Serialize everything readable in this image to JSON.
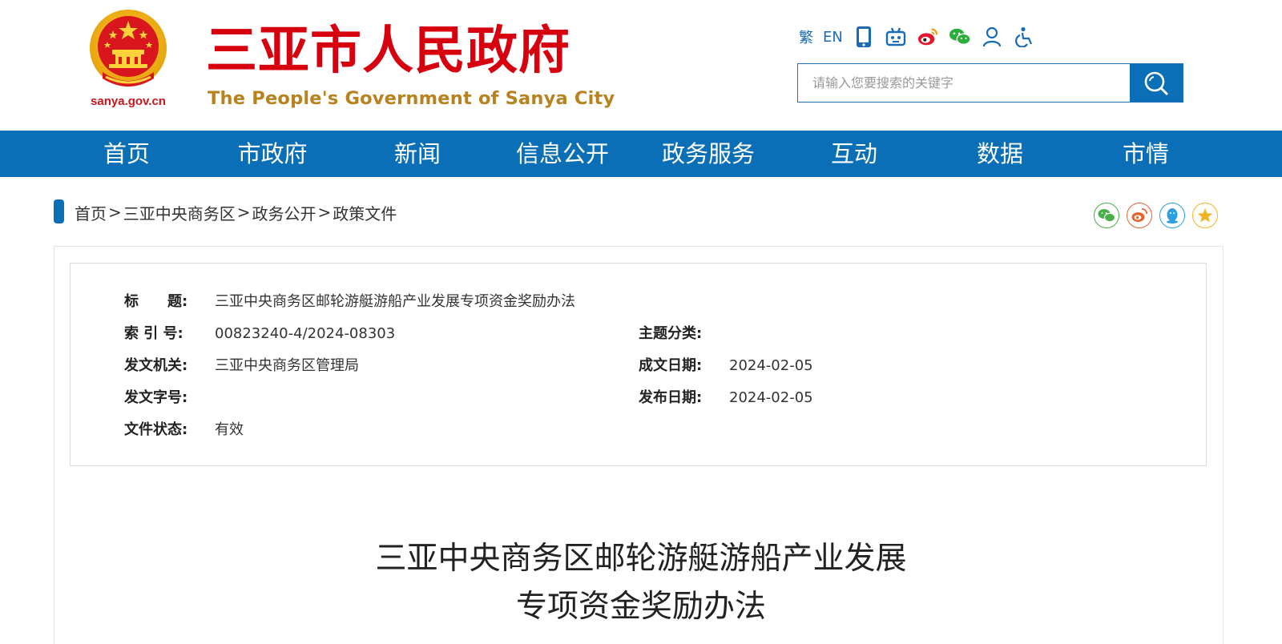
{
  "header": {
    "site_title": "三亚市人民政府",
    "site_subtitle": "The People's Government of Sanya City",
    "emblem_domain": "sanya.gov.cn",
    "toolbar": {
      "traditional": "繁",
      "english": "EN",
      "icons": [
        "mobile-icon",
        "robot-icon",
        "weibo-icon",
        "wechat-icon",
        "user-icon",
        "accessibility-icon"
      ]
    },
    "search": {
      "placeholder": "请输入您要搜索的关键字"
    }
  },
  "nav": [
    "首页",
    "市政府",
    "新闻",
    "信息公开",
    "政务服务",
    "互动",
    "数据",
    "市情"
  ],
  "breadcrumb": [
    "首页",
    "三亚中央商务区",
    "政务公开",
    "政策文件"
  ],
  "breadcrumb_separator": ">",
  "share_icons": [
    "wechat-share-icon",
    "weibo-share-icon",
    "qq-share-icon",
    "favorite-star-icon"
  ],
  "meta": {
    "title_label": "标　　题:",
    "title_value": "三亚中央商务区邮轮游艇游船产业发展专项资金奖励办法",
    "index_label": "索 引 号:",
    "index_value": "00823240-4/2024-08303",
    "subject_label": "主题分类:",
    "subject_value": "",
    "issuer_label": "发文机关:",
    "issuer_value": "三亚中央商务区管理局",
    "created_label": "成文日期:",
    "created_value": "2024-02-05",
    "docno_label": "发文字号:",
    "docno_value": "",
    "published_label": "发布日期:",
    "published_value": "2024-02-05",
    "status_label": "文件状态:",
    "status_value": "有效"
  },
  "document": {
    "title_line1": "三亚中央商务区邮轮游艇游船产业发展",
    "title_line2": "专项资金奖励办法"
  },
  "colors": {
    "brand_blue": "#0a6fb7",
    "title_red": "#d7000f",
    "subtitle_gold": "#b8821e"
  }
}
